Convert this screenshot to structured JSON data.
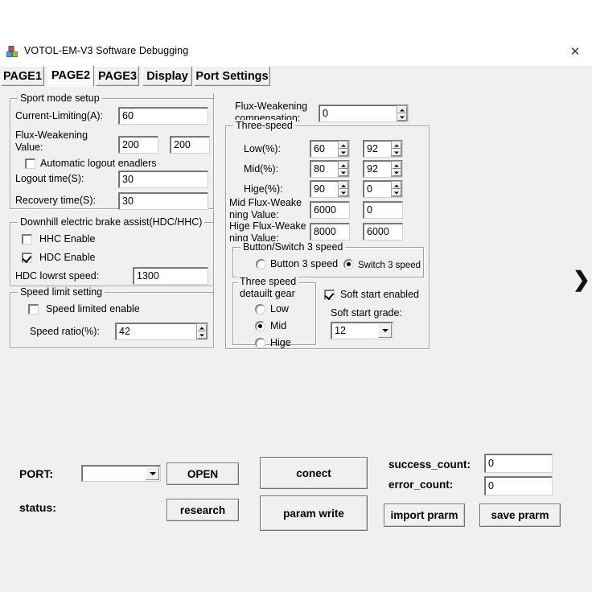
{
  "window": {
    "title": "VOTOL-EM-V3 Software Debugging",
    "icon": "app-blocks-icon",
    "close_label": "✕"
  },
  "tabs": [
    {
      "label": "PAGE1",
      "selected": false
    },
    {
      "label": "PAGE2",
      "selected": true
    },
    {
      "label": "PAGE3",
      "selected": false
    },
    {
      "label": "Display",
      "selected": false
    },
    {
      "label": "Port Settings",
      "selected": false
    }
  ],
  "sport_mode": {
    "group_label": "Sport mode setup",
    "current_limiting_label": "Current-Limiting(A):",
    "current_limiting_value": "60",
    "flux_weakening_label": "Flux-Weakening\nValue:",
    "flux_weakening_value_1": "200",
    "flux_weakening_value_2": "200",
    "auto_logout_label": "Automatic logout enadlers",
    "auto_logout_checked": false,
    "logout_time_label": "Logout time(S):",
    "logout_time_value": "30",
    "recovery_time_label": "Recovery time(S):",
    "recovery_time_value": "30"
  },
  "downhill": {
    "group_label": "Downhill electric brake assist(HDC/HHC)",
    "hhc_label": "HHC Enable",
    "hhc_checked": false,
    "hdc_label": "HDC Enable",
    "hdc_checked": true,
    "hdc_lowest_label": "HDC lowrst speed:",
    "hdc_lowest_value": "1300"
  },
  "speed_limit": {
    "group_label": "Speed limit setting",
    "enable_label": "Speed limited enable",
    "enable_checked": false,
    "ratio_label": "Speed ratio(%):",
    "ratio_value": "42"
  },
  "flux_comp": {
    "label": "Flux-Weakening\ncompensation:",
    "value": "0"
  },
  "three_speed": {
    "group_label": "Three-speed",
    "rows": [
      {
        "label": "Low(%):",
        "v1": "60",
        "v2": "92",
        "spin": true
      },
      {
        "label": "Mid(%):",
        "v1": "80",
        "v2": "92",
        "spin": true
      },
      {
        "label": "Hige(%):",
        "v1": "90",
        "v2": "0",
        "spin": true
      }
    ],
    "mid_flux_label": "Mid Flux-Weake\nning Value:",
    "mid_flux_v1": "6000",
    "mid_flux_v2": "0",
    "hige_flux_label": "Hige Flux-Weake\nning Value:",
    "hige_flux_v1": "8000",
    "hige_flux_v2": "6000"
  },
  "button_switch": {
    "group_label": "Button/Switch 3 speed",
    "option_button": "Button 3 speed",
    "option_switch": "Switch 3 speed",
    "selected": "switch"
  },
  "default_gear": {
    "group_label": "Three speed\ndetauilt gear",
    "options": [
      {
        "label": "Low",
        "selected": false
      },
      {
        "label": "Mid",
        "selected": true
      },
      {
        "label": "Hige",
        "selected": false
      }
    ]
  },
  "soft_start": {
    "enable_label": "Soft start enabled",
    "enable_checked": true,
    "grade_label": "Soft start grade:",
    "grade_value": "12"
  },
  "nav": {
    "next_arrow": "❯"
  },
  "footer": {
    "port_label": "PORT:",
    "port_value": "",
    "status_label": "status:",
    "status_value": "",
    "open_button": "OPEN",
    "research_button": "research",
    "connect_button": "conect",
    "param_write_button": "param write",
    "success_count_label": "success_count:",
    "success_count_value": "0",
    "error_count_label": "error_count:",
    "error_count_value": "0",
    "import_button": "import prarm",
    "save_button": "save prarm"
  },
  "colors": {
    "window_bg": "#f0f0f0",
    "field_bg": "#ffffff",
    "border": "#a0a0a0",
    "text": "#000000"
  }
}
